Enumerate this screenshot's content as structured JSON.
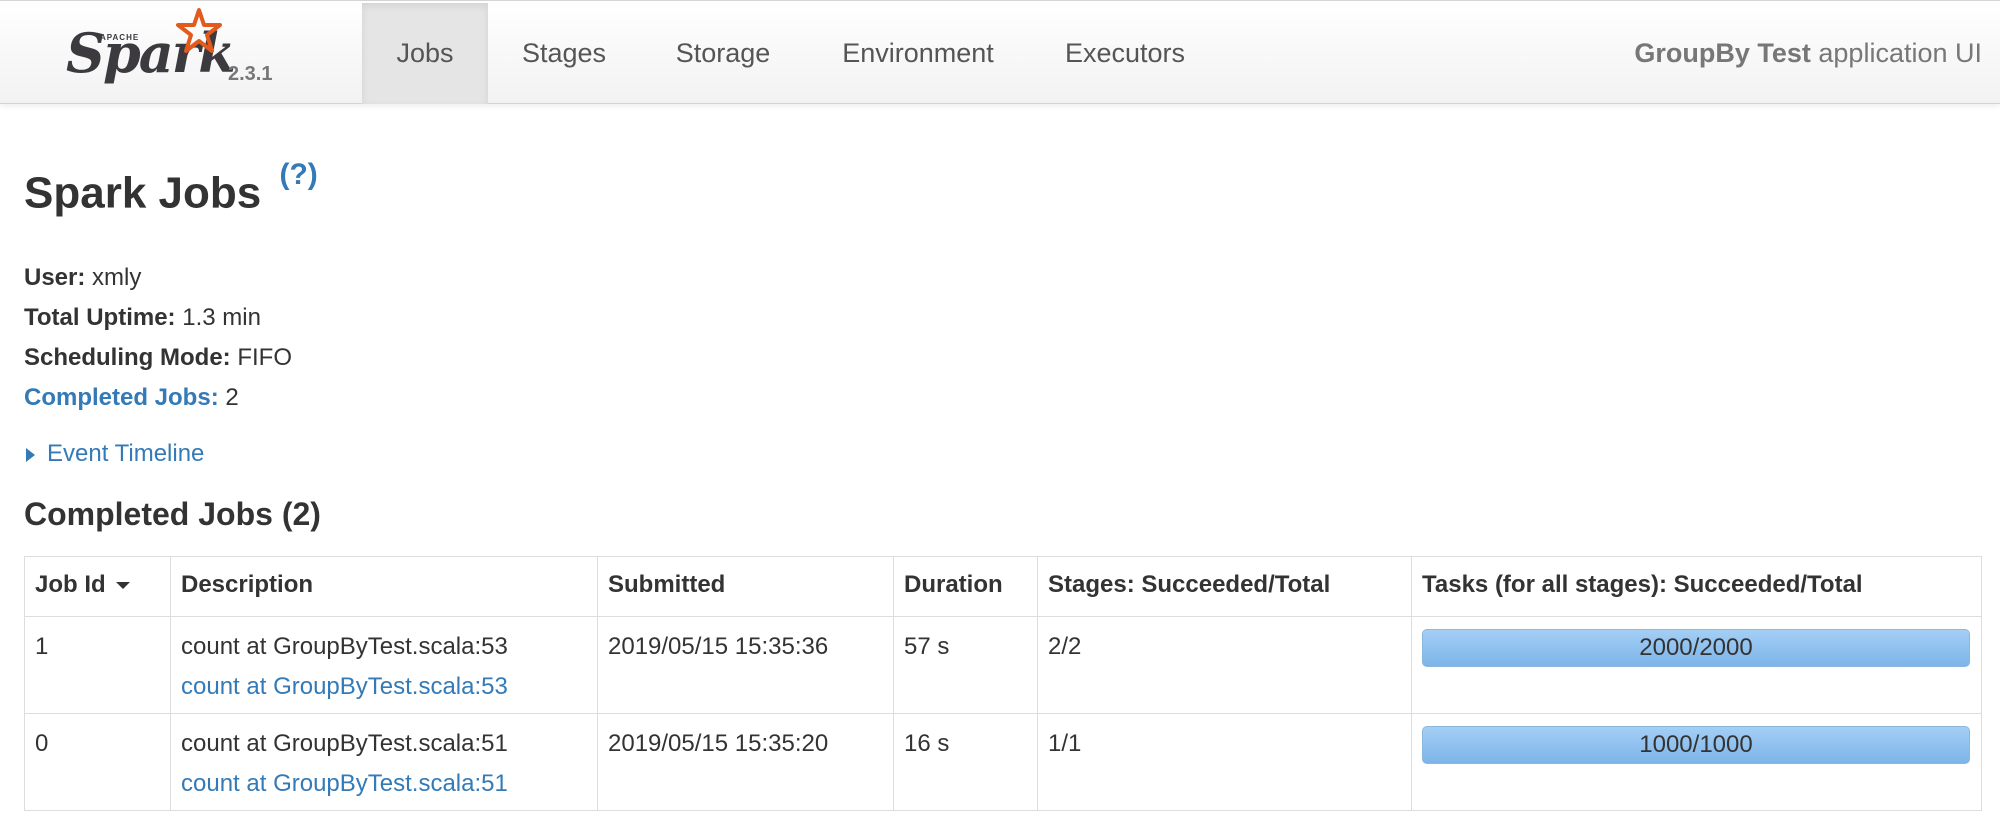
{
  "nav": {
    "version": "2.3.1",
    "tabs": [
      {
        "label": "Jobs",
        "active": true
      },
      {
        "label": "Stages",
        "active": false
      },
      {
        "label": "Storage",
        "active": false
      },
      {
        "label": "Environment",
        "active": false
      },
      {
        "label": "Executors",
        "active": false
      }
    ],
    "app_name": "GroupBy Test",
    "app_suffix": " application UI"
  },
  "page": {
    "title": "Spark Jobs",
    "help": "(?)"
  },
  "summary": {
    "user_label": "User:",
    "user_value": " xmly",
    "uptime_label": "Total Uptime:",
    "uptime_value": " 1.3 min",
    "mode_label": "Scheduling Mode:",
    "mode_value": " FIFO",
    "completed_label": "Completed Jobs:",
    "completed_value": " 2"
  },
  "timeline": {
    "label": "Event Timeline"
  },
  "completed_jobs": {
    "title": "Completed Jobs (2)",
    "headers": {
      "job_id": "Job Id",
      "description": "Description",
      "submitted": "Submitted",
      "duration": "Duration",
      "stages": "Stages: Succeeded/Total",
      "tasks": "Tasks (for all stages): Succeeded/Total"
    },
    "rows": [
      {
        "job_id": "1",
        "description": "count at GroupByTest.scala:53",
        "description_link": "count at GroupByTest.scala:53",
        "submitted": "2019/05/15 15:35:36",
        "duration": "57 s",
        "stages": "2/2",
        "tasks": "2000/2000",
        "tasks_fraction": 1.0
      },
      {
        "job_id": "0",
        "description": "count at GroupByTest.scala:51",
        "description_link": "count at GroupByTest.scala:51",
        "submitted": "2019/05/15 15:35:20",
        "duration": "16 s",
        "stages": "1/1",
        "tasks": "1000/1000",
        "tasks_fraction": 1.0
      }
    ]
  },
  "colors": {
    "link": "#337ab7",
    "progress": "#7db4e9",
    "spark_orange": "#e25a1c"
  },
  "icons": {
    "logo": "spark-star-icon",
    "sort": "caret-down-icon",
    "expand": "caret-right-icon"
  }
}
